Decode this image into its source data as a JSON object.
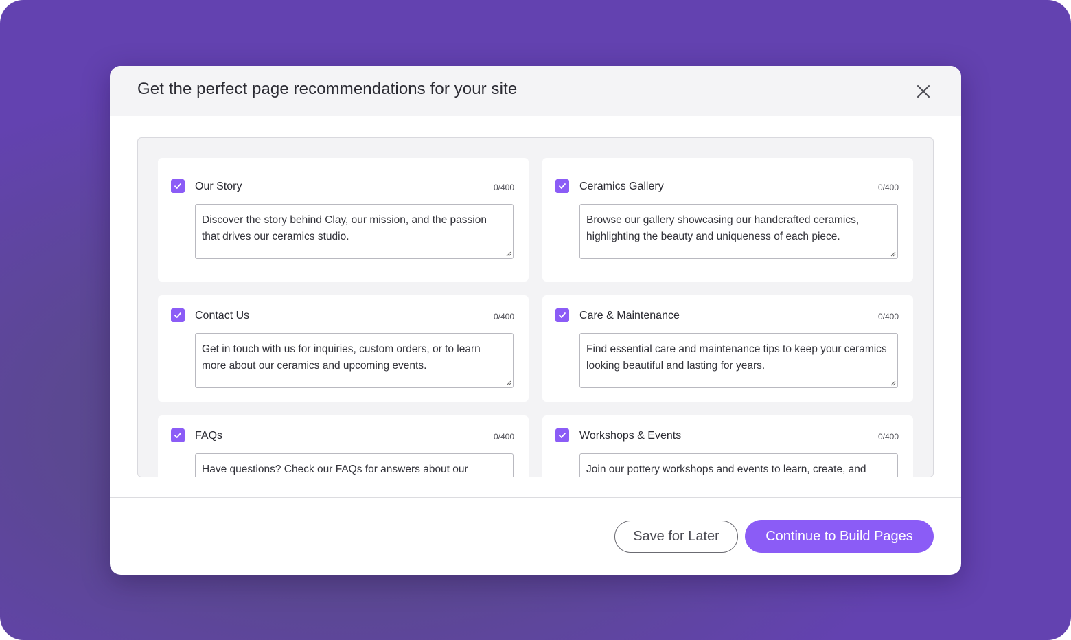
{
  "modal": {
    "title": "Get the perfect page recommendations for your site",
    "close_icon": "close-icon"
  },
  "pages": [
    {
      "label": "Our Story",
      "checked": true,
      "count": "0/400",
      "text": "Discover the story behind Clay, our mission, and the passion that drives our ceramics studio."
    },
    {
      "label": "Ceramics Gallery",
      "checked": true,
      "count": "0/400",
      "text": "Browse our gallery showcasing our handcrafted ceramics, highlighting the beauty and uniqueness of each piece."
    },
    {
      "label": "Contact Us",
      "checked": true,
      "count": "0/400",
      "text": "Get in touch with us for inquiries, custom orders, or to learn more about our ceramics and upcoming events."
    },
    {
      "label": "Care & Maintenance",
      "checked": true,
      "count": "0/400",
      "text": "Find essential care and maintenance tips to keep your ceramics looking beautiful and lasting for years."
    },
    {
      "label": "FAQs",
      "checked": true,
      "count": "0/400",
      "text": "Have questions? Check our FAQs for answers about our"
    },
    {
      "label": "Workshops & Events",
      "checked": true,
      "count": "0/400",
      "text": "Join our pottery workshops and events to learn, create, and"
    }
  ],
  "footer": {
    "save_label": "Save for Later",
    "continue_label": "Continue to Build Pages"
  },
  "colors": {
    "accent": "#8b5cf6",
    "backdrop": "#6342b0"
  }
}
